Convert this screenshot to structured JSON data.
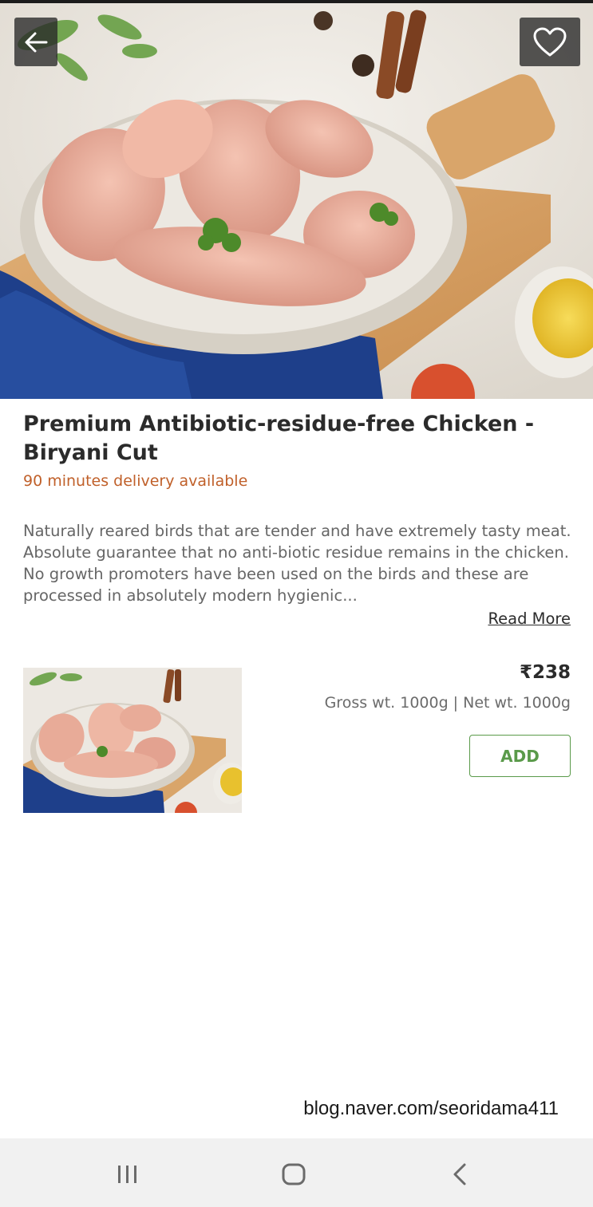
{
  "product": {
    "title": "Premium Antibiotic-residue-free Chicken - Biryani Cut",
    "delivery_text": "90 minutes delivery available",
    "description": "Naturally reared birds that are tender and have extremely tasty meat. Absolute guarantee that no anti-biotic residue remains in the chicken. No growth promoters have been used on the birds and these are processed in absolutely modern hygienic...",
    "read_more_label": "Read More"
  },
  "variant": {
    "price": "₹238",
    "weight": "Gross wt. 1000g | Net wt. 1000g",
    "add_label": "ADD"
  },
  "header_icons": {
    "back": "arrow-left-icon",
    "favorite": "heart-icon"
  },
  "navbar_icons": [
    "recent-apps-icon",
    "home-icon",
    "back-chevron-icon"
  ],
  "watermark": "blog.naver.com/seoridama411",
  "colors": {
    "delivery": "#c0602a",
    "add_button": "#5a9a4a",
    "title": "#2b2b2b",
    "body_text": "#666666"
  }
}
